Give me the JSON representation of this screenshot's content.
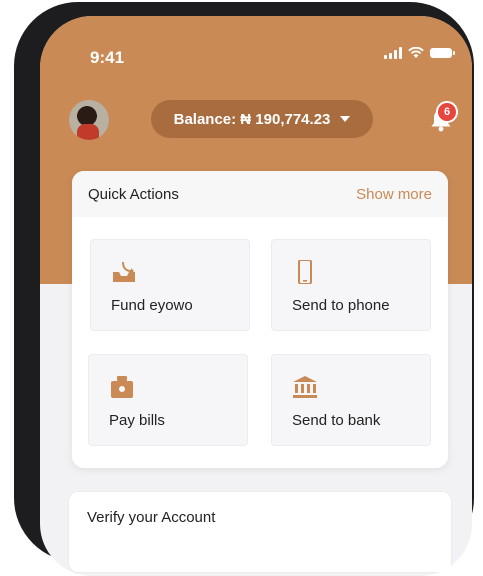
{
  "status_bar": {
    "time": "9:41",
    "signal_icon": "signal-icon",
    "wifi_icon": "wifi-icon",
    "battery_icon": "battery-icon"
  },
  "header": {
    "balance_label": "Balance: ₦ 190,774.23",
    "notification_count": "6",
    "avatar_icon": "avatar",
    "bell_icon": "bell-icon"
  },
  "quick_actions": {
    "title": "Quick Actions",
    "show_more": "Show more",
    "tiles": [
      {
        "label": "Fund eyowo",
        "icon": "inbox-tray-icon"
      },
      {
        "label": "Send to phone",
        "icon": "phone-icon"
      },
      {
        "label": "Pay bills",
        "icon": "bill-box-icon"
      },
      {
        "label": "Send to bank",
        "icon": "bank-icon"
      }
    ]
  },
  "verify": {
    "title": "Verify your Account"
  },
  "colors": {
    "brand": "#c98a55",
    "pill": "#a86c3f",
    "badge": "#e8453c"
  }
}
